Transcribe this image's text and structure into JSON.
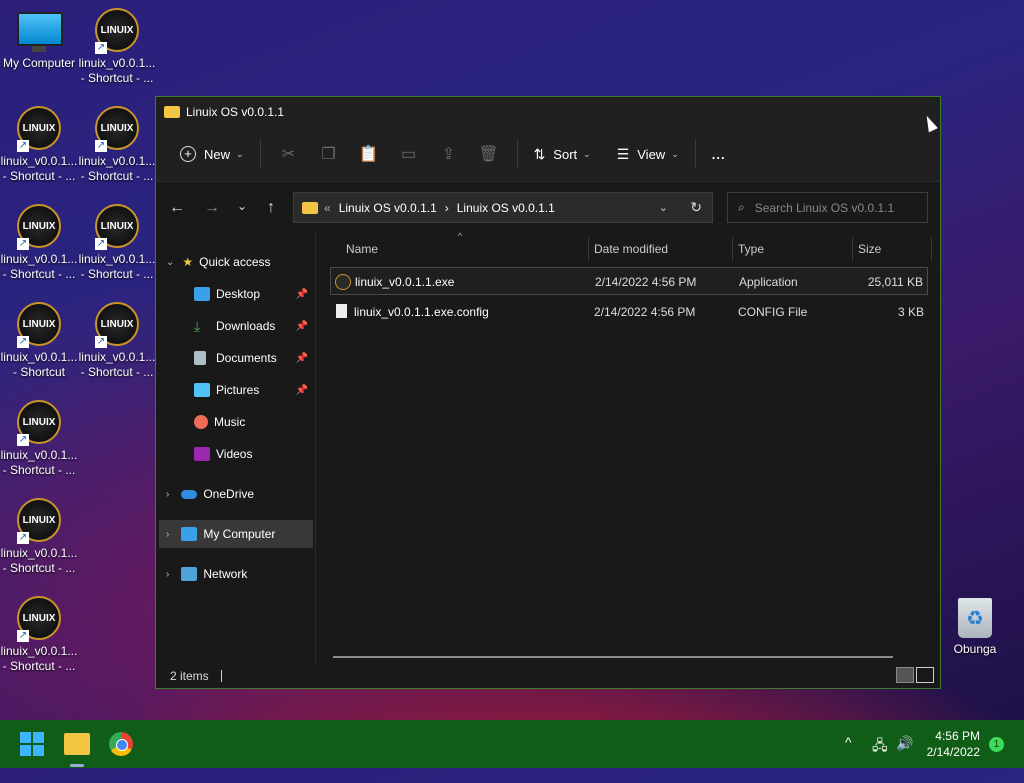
{
  "desktop": {
    "icons": [
      {
        "label": "My Computer",
        "kind": "monitor-icon"
      },
      {
        "label": "linuix_v0.0.1... - Shortcut - ...",
        "kind": "linuix-icon"
      },
      {
        "label": "linuix_v0.0.1... - Shortcut - ...",
        "kind": "linuix-icon"
      },
      {
        "label": "linuix_v0.0.1... - Shortcut - ...",
        "kind": "linuix-icon"
      },
      {
        "label": "linuix_v0.0.1... - Shortcut - ...",
        "kind": "linuix-icon"
      },
      {
        "label": "linuix_v0.0.1... - Shortcut - ...",
        "kind": "linuix-icon"
      },
      {
        "label": "linuix_v0.0.1... - Shortcut",
        "kind": "linuix-icon"
      },
      {
        "label": "linuix_v0.0.1... - Shortcut - ...",
        "kind": "linuix-icon"
      },
      {
        "label": "linuix_v0.0.1... - Shortcut - ...",
        "kind": "linuix-icon"
      },
      {
        "label": "linuix_v0.0.1... - Shortcut - ...",
        "kind": "linuix-icon"
      },
      {
        "label": "linuix_v0.0.1... - Shortcut - ...",
        "kind": "linuix-icon"
      },
      {
        "label": "Obunga",
        "kind": "recycle-bin-icon"
      }
    ],
    "logo_text": "LINUIX"
  },
  "window": {
    "title": "Linuix OS v0.0.1.1",
    "toolbar": {
      "new_label": "New",
      "sort_label": "Sort",
      "view_label": "View",
      "more_label": "..."
    },
    "address": {
      "overflow": "«",
      "segments": [
        "Linuix OS v0.0.1.1",
        "Linuix OS v0.0.1.1"
      ],
      "separator": "›"
    },
    "search": {
      "placeholder": "Search Linuix OS v0.0.1.1"
    },
    "sidebar": {
      "quick_access": "Quick access",
      "items": [
        {
          "label": "Desktop",
          "pinned": true,
          "color": "#3aa0e8"
        },
        {
          "label": "Downloads",
          "pinned": true,
          "color": "#4caf50"
        },
        {
          "label": "Documents",
          "pinned": true,
          "color": "#b0bec5"
        },
        {
          "label": "Pictures",
          "pinned": true,
          "color": "#4fc3f7"
        },
        {
          "label": "Music",
          "pinned": false,
          "color": "#ef6c57"
        },
        {
          "label": "Videos",
          "pinned": false,
          "color": "#9c27b0"
        }
      ],
      "onedrive": "OneDrive",
      "my_computer": "My Computer",
      "network": "Network"
    },
    "columns": {
      "name": "Name",
      "date": "Date modified",
      "type": "Type",
      "size": "Size"
    },
    "files": [
      {
        "name": "linuix_v0.0.1.1.exe",
        "date": "2/14/2022 4:56 PM",
        "type": "Application",
        "size": "25,011 KB"
      },
      {
        "name": "linuix_v0.0.1.1.exe.config",
        "date": "2/14/2022 4:56 PM",
        "type": "CONFIG File",
        "size": "3 KB"
      }
    ],
    "status": "2 items"
  },
  "taskbar": {
    "time": "4:56 PM",
    "date": "2/14/2022",
    "notification_count": "1"
  }
}
